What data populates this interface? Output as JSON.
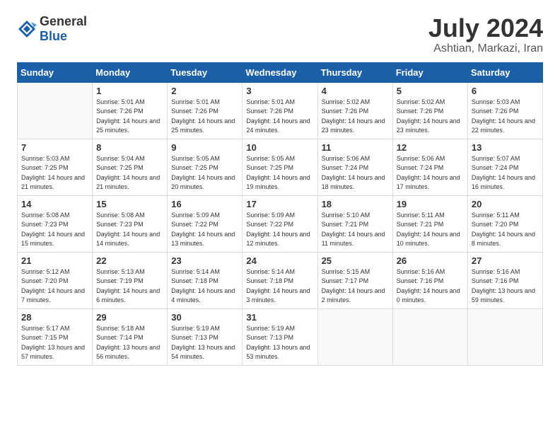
{
  "header": {
    "logo_general": "General",
    "logo_blue": "Blue",
    "month_title": "July 2024",
    "location": "Ashtian, Markazi, Iran"
  },
  "days_of_week": [
    "Sunday",
    "Monday",
    "Tuesday",
    "Wednesday",
    "Thursday",
    "Friday",
    "Saturday"
  ],
  "weeks": [
    [
      {
        "day": "",
        "empty": true
      },
      {
        "day": "1",
        "sunrise": "5:01 AM",
        "sunset": "7:26 PM",
        "daylight": "14 hours and 25 minutes."
      },
      {
        "day": "2",
        "sunrise": "5:01 AM",
        "sunset": "7:26 PM",
        "daylight": "14 hours and 25 minutes."
      },
      {
        "day": "3",
        "sunrise": "5:01 AM",
        "sunset": "7:26 PM",
        "daylight": "14 hours and 24 minutes."
      },
      {
        "day": "4",
        "sunrise": "5:02 AM",
        "sunset": "7:26 PM",
        "daylight": "14 hours and 23 minutes."
      },
      {
        "day": "5",
        "sunrise": "5:02 AM",
        "sunset": "7:26 PM",
        "daylight": "14 hours and 23 minutes."
      },
      {
        "day": "6",
        "sunrise": "5:03 AM",
        "sunset": "7:26 PM",
        "daylight": "14 hours and 22 minutes."
      }
    ],
    [
      {
        "day": "7",
        "sunrise": "5:03 AM",
        "sunset": "7:25 PM",
        "daylight": "14 hours and 21 minutes."
      },
      {
        "day": "8",
        "sunrise": "5:04 AM",
        "sunset": "7:25 PM",
        "daylight": "14 hours and 21 minutes."
      },
      {
        "day": "9",
        "sunrise": "5:05 AM",
        "sunset": "7:25 PM",
        "daylight": "14 hours and 20 minutes."
      },
      {
        "day": "10",
        "sunrise": "5:05 AM",
        "sunset": "7:25 PM",
        "daylight": "14 hours and 19 minutes."
      },
      {
        "day": "11",
        "sunrise": "5:06 AM",
        "sunset": "7:24 PM",
        "daylight": "14 hours and 18 minutes."
      },
      {
        "day": "12",
        "sunrise": "5:06 AM",
        "sunset": "7:24 PM",
        "daylight": "14 hours and 17 minutes."
      },
      {
        "day": "13",
        "sunrise": "5:07 AM",
        "sunset": "7:24 PM",
        "daylight": "14 hours and 16 minutes."
      }
    ],
    [
      {
        "day": "14",
        "sunrise": "5:08 AM",
        "sunset": "7:23 PM",
        "daylight": "14 hours and 15 minutes."
      },
      {
        "day": "15",
        "sunrise": "5:08 AM",
        "sunset": "7:23 PM",
        "daylight": "14 hours and 14 minutes."
      },
      {
        "day": "16",
        "sunrise": "5:09 AM",
        "sunset": "7:22 PM",
        "daylight": "14 hours and 13 minutes."
      },
      {
        "day": "17",
        "sunrise": "5:09 AM",
        "sunset": "7:22 PM",
        "daylight": "14 hours and 12 minutes."
      },
      {
        "day": "18",
        "sunrise": "5:10 AM",
        "sunset": "7:21 PM",
        "daylight": "14 hours and 11 minutes."
      },
      {
        "day": "19",
        "sunrise": "5:11 AM",
        "sunset": "7:21 PM",
        "daylight": "14 hours and 10 minutes."
      },
      {
        "day": "20",
        "sunrise": "5:11 AM",
        "sunset": "7:20 PM",
        "daylight": "14 hours and 8 minutes."
      }
    ],
    [
      {
        "day": "21",
        "sunrise": "5:12 AM",
        "sunset": "7:20 PM",
        "daylight": "14 hours and 7 minutes."
      },
      {
        "day": "22",
        "sunrise": "5:13 AM",
        "sunset": "7:19 PM",
        "daylight": "14 hours and 6 minutes."
      },
      {
        "day": "23",
        "sunrise": "5:14 AM",
        "sunset": "7:18 PM",
        "daylight": "14 hours and 4 minutes."
      },
      {
        "day": "24",
        "sunrise": "5:14 AM",
        "sunset": "7:18 PM",
        "daylight": "14 hours and 3 minutes."
      },
      {
        "day": "25",
        "sunrise": "5:15 AM",
        "sunset": "7:17 PM",
        "daylight": "14 hours and 2 minutes."
      },
      {
        "day": "26",
        "sunrise": "5:16 AM",
        "sunset": "7:16 PM",
        "daylight": "14 hours and 0 minutes."
      },
      {
        "day": "27",
        "sunrise": "5:16 AM",
        "sunset": "7:16 PM",
        "daylight": "13 hours and 59 minutes."
      }
    ],
    [
      {
        "day": "28",
        "sunrise": "5:17 AM",
        "sunset": "7:15 PM",
        "daylight": "13 hours and 57 minutes."
      },
      {
        "day": "29",
        "sunrise": "5:18 AM",
        "sunset": "7:14 PM",
        "daylight": "13 hours and 56 minutes."
      },
      {
        "day": "30",
        "sunrise": "5:19 AM",
        "sunset": "7:13 PM",
        "daylight": "13 hours and 54 minutes."
      },
      {
        "day": "31",
        "sunrise": "5:19 AM",
        "sunset": "7:13 PM",
        "daylight": "13 hours and 53 minutes."
      },
      {
        "day": "",
        "empty": true
      },
      {
        "day": "",
        "empty": true
      },
      {
        "day": "",
        "empty": true
      }
    ]
  ],
  "labels": {
    "sunrise_label": "Sunrise:",
    "sunset_label": "Sunset:",
    "daylight_label": "Daylight:"
  }
}
